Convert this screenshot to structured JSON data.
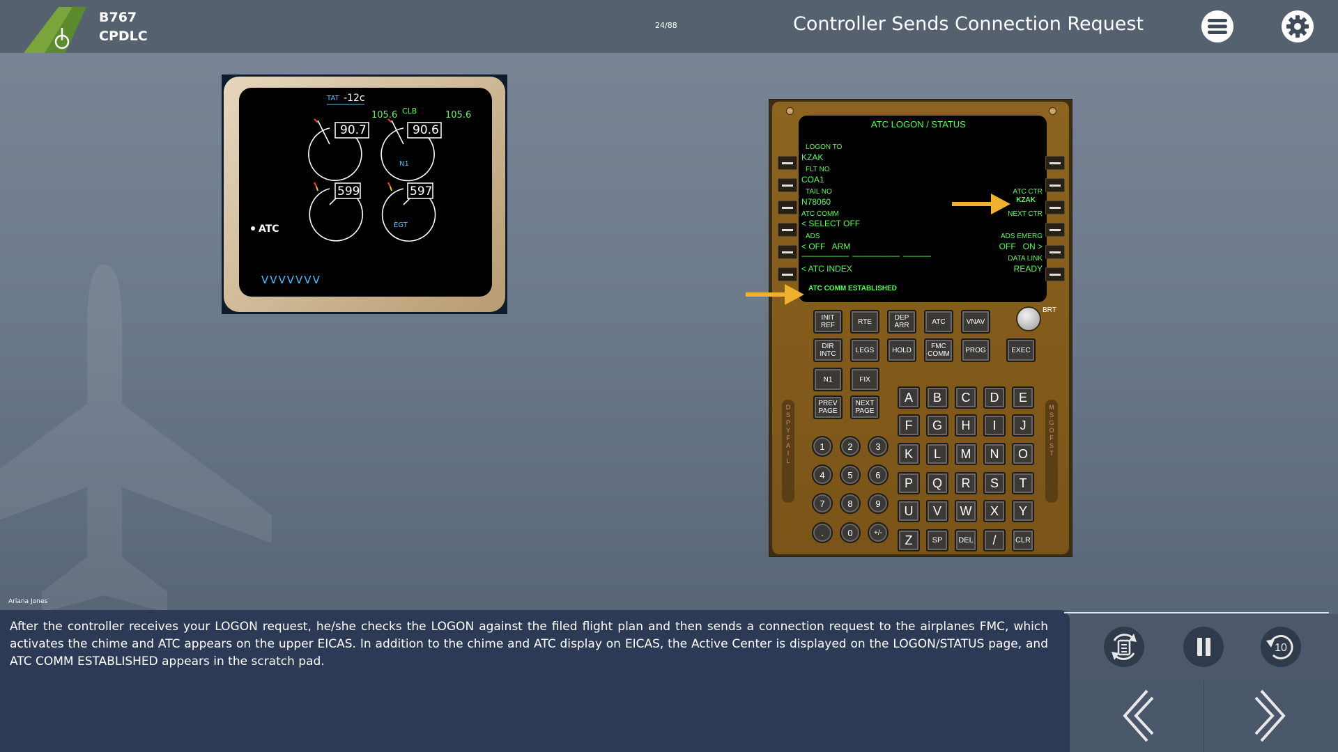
{
  "header": {
    "aircraft": "B767",
    "course": "CPDLC",
    "slide_counter": "24/88",
    "lesson_title": "Controller Sends Connection Request"
  },
  "eicas": {
    "tat_label": "TAT",
    "tat_value": "-12c",
    "thrust_mode": "CLB",
    "n1_limit_left": "105.6",
    "n1_limit_right": "105.6",
    "n1_left": "90.7",
    "n1_right": "90.6",
    "n1_label": "N1",
    "egt_left": "599",
    "egt_right": "597",
    "egt_label": "EGT",
    "alert_message": "ATC",
    "bottom_marks": "VVVVVVV"
  },
  "fmc": {
    "page_title": "ATC LOGON / STATUS",
    "l1_label": "LOGON TO",
    "l1_value": "KZAK",
    "l2_label": "FLT NO",
    "l2_value": "COA1",
    "l3_label": "TAIL NO",
    "l3_value": "N78060",
    "r3_label": "ATC CTR",
    "r3_value": "KZAK",
    "l4_label": "ATC COMM",
    "l4_value": "< SELECT OFF",
    "r4_label": "NEXT CTR",
    "l5_label": "ADS",
    "l5_value": "< OFF   ARM",
    "r5_label": "ADS EMERG",
    "r5_value": "OFF   ON >",
    "l6_dashes": "-----------------------------   -----------------------------   -----------------",
    "r6_label": "DATA LINK",
    "l6_value": "< ATC INDEX",
    "r6_value": "READY",
    "scratchpad": "ATC COMM ESTABLISHED",
    "brt_label": "BRT",
    "fn_row1": [
      "INIT REF",
      "RTE",
      "DEP ARR",
      "ATC",
      "VNAV"
    ],
    "fn_row2": [
      "DIR INTC",
      "LEGS",
      "HOLD",
      "FMC COMM",
      "PROG"
    ],
    "exec_label": "EXEC",
    "n1_key": "N1",
    "fix_key": "FIX",
    "prev_page": "PREV PAGE",
    "next_page": "NEXT PAGE",
    "alpha_rows": [
      [
        "A",
        "B",
        "C",
        "D",
        "E"
      ],
      [
        "F",
        "G",
        "H",
        "I",
        "J"
      ],
      [
        "K",
        "L",
        "M",
        "N",
        "O"
      ],
      [
        "P",
        "Q",
        "R",
        "S",
        "T"
      ],
      [
        "U",
        "V",
        "W",
        "X",
        "Y"
      ],
      [
        "Z",
        "SP",
        "DEL",
        "/",
        "CLR"
      ]
    ],
    "num_rows": [
      [
        "1",
        "2",
        "3"
      ],
      [
        "4",
        "5",
        "6"
      ],
      [
        "7",
        "8",
        "9"
      ],
      [
        ".",
        "0",
        "+/-"
      ]
    ],
    "left_strip": "D S P Y F A I L",
    "right_strip": "M S G O F S T"
  },
  "caption": {
    "author": "Ariana Jones",
    "text": "After the controller receives your LOGON request, he/she checks the LOGON against the filed flight plan and then sends a connection request to the airplanes FMC, which activates the chime and ATC appears on the upper EICAS. In addition to the chime and ATC display on EICAS, the Active Center is displayed on the LOGON/STATUS page, and ATC COMM ESTABLISHED appears in the scratch pad."
  },
  "controls": {
    "replay": "replay-icon",
    "pause": "pause-icon",
    "rewind": "rewind-10-icon",
    "rewind_seconds": "10",
    "prev": "chevron-left-icon",
    "next": "chevron-right-icon"
  },
  "colors": {
    "accent_arrow": "#f0b030",
    "fmc_text": "#5dfc5d",
    "eicas_white": "#ffffff",
    "eicas_green": "#6cf06c",
    "eicas_cyan": "#4fc0ff"
  }
}
